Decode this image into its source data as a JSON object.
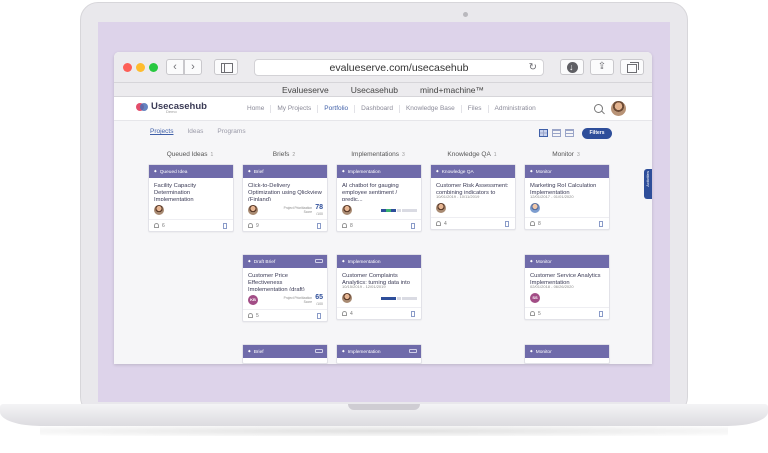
{
  "browser": {
    "url": "evalueserve.com/usecasehub",
    "favorites": [
      "Evalueserve",
      "Usecasehub",
      "mind+machine™"
    ],
    "icons": [
      "back-icon",
      "forward-icon",
      "sidebar-icon",
      "reload-icon",
      "download-icon",
      "share-icon",
      "tabs-icon"
    ]
  },
  "app": {
    "logo_text": "Usecasehub",
    "logo_sub": "Demo",
    "nav": [
      "Home",
      "My Projects",
      "Portfolio",
      "Dashboard",
      "Knowledge Base",
      "Files",
      "Administration"
    ],
    "active_nav": "Portfolio",
    "sub_tabs": [
      "Projects",
      "Ideas",
      "Programs"
    ],
    "filters_label": "Filters",
    "side_tab_label": "Activities"
  },
  "columns": [
    {
      "title": "Queued Ideas",
      "count": "1"
    },
    {
      "title": "Briefs",
      "count": "2"
    },
    {
      "title": "Implementations",
      "count": "3"
    },
    {
      "title": "Knowledge QA",
      "count": "1"
    },
    {
      "title": "Monitor",
      "count": "3"
    }
  ],
  "cards": {
    "queued_1": {
      "stage": "Queued Idea",
      "title": "Facility Capacity Determination Implementation",
      "count": "6"
    },
    "brief_1": {
      "stage": "Brief",
      "title": "Click-to-Delivery Optimization using Qlickview (Finland)",
      "score_label": "Project Prioritization Score",
      "score": "78",
      "score_max": "/100",
      "count": "9"
    },
    "brief_2": {
      "stage": "Draft Brief",
      "title": "Customer Price Effectiveness Implementation (draft)",
      "score_label": "Project Prioritization Score",
      "score": "65",
      "score_max": "/100",
      "initials": "KB",
      "count": "5"
    },
    "brief_3": {
      "stage": "Brief"
    },
    "impl_1": {
      "stage": "Implementation",
      "title": "AI chatbot for gauging employee sentiment / predic...",
      "count": "8"
    },
    "impl_2": {
      "stage": "Implementation",
      "title": "Customer Complaints Analytics: turning data into a...",
      "date": "10/15/2019 - 12/01/2019",
      "count": "4"
    },
    "impl_3": {
      "stage": "Implementation"
    },
    "kqa_1": {
      "stage": "Knowledge QA",
      "title": "Customer Risk Assessment: combining indicators to prev...",
      "date": "10/01/2019 - 10/11/2019",
      "count": "4"
    },
    "mon_1": {
      "stage": "Monitor",
      "title": "Marketing RoI Calculation Implementation",
      "date": "12/01/2017 - 01/01/2020",
      "count": "8"
    },
    "mon_2": {
      "stage": "Monitor",
      "title": "Customer Service Analytics Implementation",
      "date": "02/01/2018 - 06/26/2020",
      "initials": "SS",
      "count": "5"
    },
    "mon_3": {
      "stage": "Monitor"
    }
  },
  "colors": {
    "accent": "#2e4e9a",
    "card_header": "#6f6baa",
    "bezel": "#ddd3ea"
  }
}
